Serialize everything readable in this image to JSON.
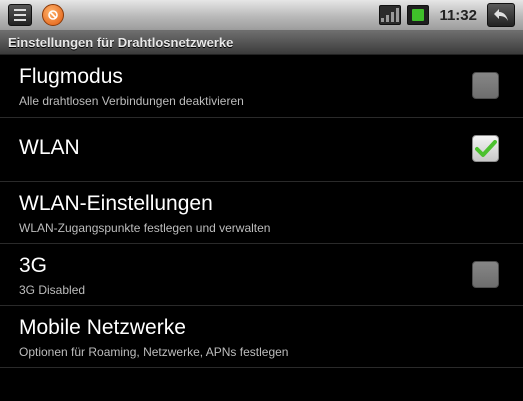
{
  "status_bar": {
    "time": "11:32",
    "icons": [
      "menu-icon",
      "alert-icon",
      "signal-icon",
      "battery-icon",
      "back-icon"
    ],
    "colors": {
      "battery": "#3fbf2a",
      "alert": "#e05a10"
    }
  },
  "title": "Einstellungen für Drahtlosnetzwerke",
  "settings": [
    {
      "title": "Flugmodus",
      "summary": "Alle drahtlosen Verbindungen deaktivieren",
      "checkbox": "unchecked"
    },
    {
      "title": "WLAN",
      "summary": "",
      "checkbox": "checked"
    },
    {
      "title": "WLAN-Einstellungen",
      "summary": "WLAN-Zugangspunkte festlegen und verwalten",
      "checkbox": "none"
    },
    {
      "title": "3G",
      "summary": "3G Disabled",
      "checkbox": "unchecked"
    },
    {
      "title": "Mobile Netzwerke",
      "summary": "Optionen für Roaming, Netzwerke, APNs festlegen",
      "checkbox": "none"
    }
  ],
  "colors": {
    "check_green": "#4cc12f",
    "background": "#000000"
  }
}
